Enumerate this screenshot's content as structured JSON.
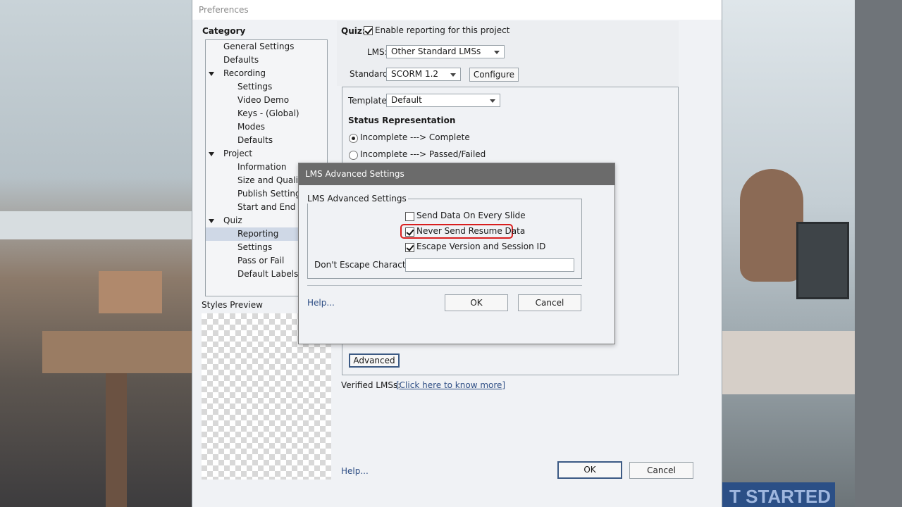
{
  "window": {
    "title": "Preferences"
  },
  "category": {
    "title": "Category",
    "tree": [
      {
        "label": "General Settings",
        "level": 1,
        "expander": false,
        "selected": false
      },
      {
        "label": "Defaults",
        "level": 1,
        "expander": false,
        "selected": false
      },
      {
        "label": "Recording",
        "level": 1,
        "expander": true,
        "selected": false
      },
      {
        "label": "Settings",
        "level": 2,
        "expander": false,
        "selected": false
      },
      {
        "label": "Video Demo",
        "level": 2,
        "expander": false,
        "selected": false
      },
      {
        "label": "Keys - (Global)",
        "level": 2,
        "expander": false,
        "selected": false
      },
      {
        "label": "Modes",
        "level": 2,
        "expander": false,
        "selected": false
      },
      {
        "label": "Defaults",
        "level": 2,
        "expander": false,
        "selected": false
      },
      {
        "label": "Project",
        "level": 1,
        "expander": true,
        "selected": false
      },
      {
        "label": "Information",
        "level": 2,
        "expander": false,
        "selected": false
      },
      {
        "label": "Size and Quality",
        "level": 2,
        "expander": false,
        "selected": false
      },
      {
        "label": "Publish Settings",
        "level": 2,
        "expander": false,
        "selected": false
      },
      {
        "label": "Start and End",
        "level": 2,
        "expander": false,
        "selected": false
      },
      {
        "label": "Quiz",
        "level": 1,
        "expander": true,
        "selected": false
      },
      {
        "label": "Reporting",
        "level": 2,
        "expander": false,
        "selected": true
      },
      {
        "label": "Settings",
        "level": 2,
        "expander": false,
        "selected": false
      },
      {
        "label": "Pass or Fail",
        "level": 2,
        "expander": false,
        "selected": false
      },
      {
        "label": "Default Labels",
        "level": 2,
        "expander": false,
        "selected": false
      }
    ]
  },
  "styles_preview": {
    "label": "Styles Preview"
  },
  "reporting": {
    "quiz_label": "Quiz:",
    "enable_label": "Enable reporting for this project",
    "enable_checked": true,
    "lms_label": "LMS:",
    "lms_value": "Other Standard LMSs",
    "standard_label": "Standard:",
    "standard_value": "SCORM 1.2",
    "configure_label": "Configure",
    "template_label": "Template:",
    "template_value": "Default",
    "status_title": "Status Representation",
    "status_options": [
      {
        "label": "Incomplete ---> Complete",
        "selected": true
      },
      {
        "label": "Incomplete ---> Passed/Failed",
        "selected": false
      }
    ],
    "advanced_label": "Advanced",
    "verified_label": "Verified LMSs:",
    "verified_link": "[Click here to know more]"
  },
  "footer": {
    "help": "Help...",
    "ok": "OK",
    "cancel": "Cancel"
  },
  "modal": {
    "title": "LMS Advanced Settings",
    "group_label": "LMS Advanced Settings",
    "options": [
      {
        "label": "Send Data On Every Slide",
        "checked": false
      },
      {
        "label": "Never Send Resume Data",
        "checked": true
      },
      {
        "label": "Escape Version and Session ID",
        "checked": true
      }
    ],
    "escape_label": "Don't Escape Characters:",
    "escape_value": "",
    "help": "Help...",
    "ok": "OK",
    "cancel": "Cancel"
  },
  "background": {
    "banner_text": "T STARTED"
  },
  "colors": {
    "highlight": "#d81e1e",
    "selection": "#cfd8e6",
    "link": "#2f4f85",
    "modal_title_bg": "#6b6b6b"
  }
}
